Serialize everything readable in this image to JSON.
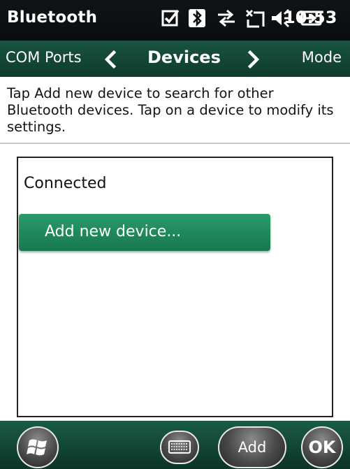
{
  "status_bar": {
    "title": "Bluetooth",
    "time": "10:53",
    "icons": [
      "tasks-checkbox-icon",
      "bluetooth-icon",
      "sync-arrows-icon",
      "no-signal-icon",
      "volume-icon",
      "battery-charging-icon"
    ]
  },
  "tab_bar": {
    "left_label": "COM Ports",
    "center_label": "Devices",
    "right_label": "Mode"
  },
  "instructions": "Tap Add new device to search for other Bluetooth devices. Tap on a device to modify its settings.",
  "device_list": {
    "section_label": "Connected",
    "add_button_label": "Add new device..."
  },
  "bottom_bar": {
    "add_label": "Add",
    "ok_label": "OK"
  },
  "colors": {
    "status_bar_bg": "#0c1012",
    "tab_bar_bg": "#15503e",
    "add_device_green": "#1f8a5a",
    "bottom_bar_bg": "#124a37"
  }
}
